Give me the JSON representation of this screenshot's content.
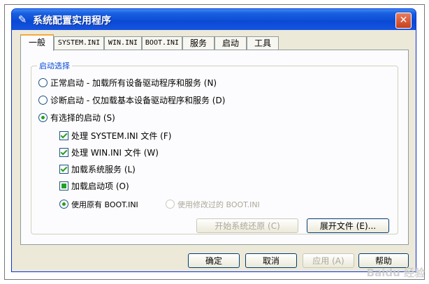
{
  "window": {
    "title": "系统配置实用程序",
    "close_glyph": "✕",
    "app_icon": "msconfig-icon"
  },
  "tabs": [
    {
      "label": "一般",
      "active": true
    },
    {
      "label": "SYSTEM.INI"
    },
    {
      "label": "WIN.INI"
    },
    {
      "label": "BOOT.INI"
    },
    {
      "label": "服务"
    },
    {
      "label": "启动"
    },
    {
      "label": "工具"
    }
  ],
  "startup": {
    "group_label": "启动选择",
    "normal": "正常启动 - 加载所有设备驱动程序和服务 (N)",
    "diagnostic": "诊断启动 - 仅加载基本设备驱动程序和服务 (D)",
    "selective": "有选择的启动 (S)",
    "process_system_ini": "处理 SYSTEM.INI 文件 (F)",
    "process_win_ini": "处理 WIN.INI 文件 (W)",
    "load_services": "加载系统服务 (L)",
    "load_startup": "加载启动项 (O)",
    "use_original_boot": "使用原有 BOOT.INI",
    "use_modified_boot": "使用修改过的 BOOT.INI",
    "restore_button": "开始系统还原 (C)",
    "expand_button": "展开文件 (E)..."
  },
  "footer": {
    "ok": "确定",
    "cancel": "取消",
    "apply": "应用 (A)",
    "help": "帮助"
  },
  "watermark": "Baidu 经验"
}
